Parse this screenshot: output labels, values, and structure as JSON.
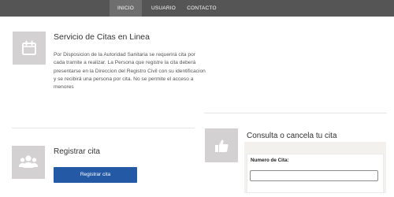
{
  "nav": {
    "items": [
      {
        "label": "INICIO",
        "active": true
      },
      {
        "label": "USUARIO",
        "active": false
      },
      {
        "label": "CONTACTO",
        "active": false
      }
    ]
  },
  "info": {
    "icon": "calendar-icon",
    "title": "Servicio de Citas en Linea",
    "description": "Por Disposicion de la Autoridad Sanitaria se requerirá cita por cada tramite a realizar. La Persona que registre la cita deberá presentarse en la Direccion del Registro Civil con su identificacion y se recibirá una persona por cita. No se permite el acceso a menores"
  },
  "registrar": {
    "icon": "users-icon",
    "title": "Registrar cita",
    "button_label": "Registrar cita"
  },
  "consulta": {
    "icon": "thumbs-up-icon",
    "title": "Consulta o cancela tu cita",
    "field_label": "Numero de Cita:",
    "field_value": "",
    "field_placeholder": ""
  },
  "colors": {
    "navbar": "#555555",
    "nav_active": "#6e6e6e",
    "tile": "#d3d1d1",
    "button": "#2459a6",
    "panel": "#f2f1ed"
  }
}
